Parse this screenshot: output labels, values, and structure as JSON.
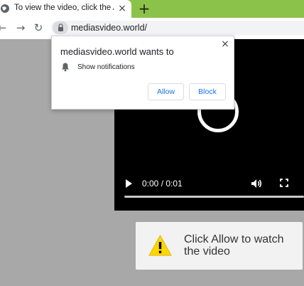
{
  "browser": {
    "tab": {
      "title": "To view the video, click the Allow",
      "close_glyph": "×",
      "favicon": "globe-icon"
    },
    "new_tab_glyph": "+",
    "nav": {
      "back_glyph": "←",
      "forward_glyph": "→",
      "reload_glyph": "↻"
    },
    "address": {
      "url": "mediasvideo.world/",
      "lock_icon": "lock-icon"
    }
  },
  "notification_prompt": {
    "title": "mediasvideo.world wants to",
    "close_glyph": "×",
    "permission": "Show notifications",
    "permission_icon": "bell-icon",
    "allow_label": "Allow",
    "block_label": "Block"
  },
  "video_player": {
    "time": "0:00 / 0:01",
    "progress_fraction": 0,
    "icons": [
      "play-icon",
      "volume-icon",
      "fullscreen-icon",
      "loading-spinner"
    ]
  },
  "banner": {
    "text": "Click Allow to watch the video",
    "icon": "warning-icon"
  },
  "colors": {
    "tabstrip": "#8bc34a",
    "page_background": "#a8a8a8",
    "accent": "#1a73e8",
    "warning": "#ffd600"
  }
}
